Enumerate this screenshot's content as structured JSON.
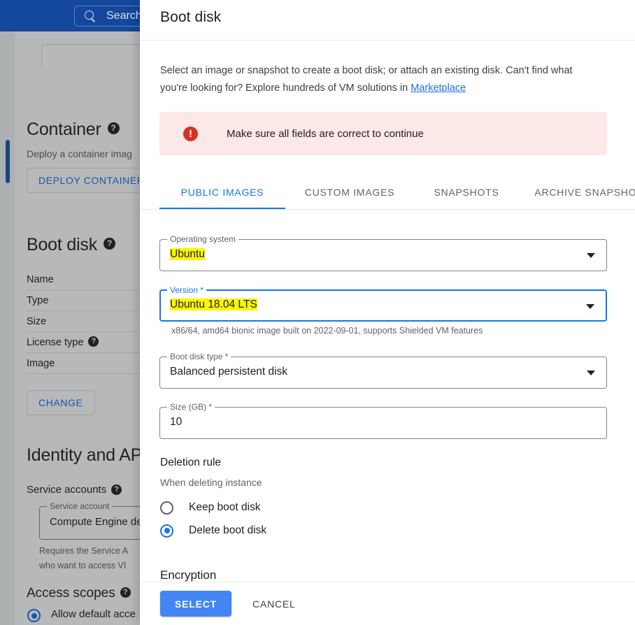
{
  "topbar": {
    "search_placeholder": "Search",
    "search_icon": "search-icon"
  },
  "background": {
    "container": {
      "heading": "Container",
      "help_icon": "?",
      "subtitle": "Deploy a container imag",
      "deploy_button": "DEPLOY CONTAINER"
    },
    "boot_disk": {
      "heading": "Boot disk",
      "help_icon": "?",
      "rows": [
        "Name",
        "Type",
        "Size",
        "License type",
        "Image"
      ],
      "license_help_icon": "?",
      "change_button": "CHANGE"
    },
    "identity": {
      "heading": "Identity and AP",
      "service_accounts_label": "Service accounts",
      "service_accounts_help_icon": "?",
      "service_account_field_label": "Service account",
      "service_account_value": "Compute Engine def",
      "hint_line1": "Requires the Service A",
      "hint_line2": "who want to access VI",
      "access_scopes_label": "Access scopes",
      "access_scopes_help_icon": "?",
      "access_scope_option": "Allow default acce"
    }
  },
  "dialog": {
    "title": "Boot disk",
    "description_part1": "Select an image or snapshot to create a boot disk; or attach an existing disk. Can't find what you're looking for? Explore hundreds of VM solutions in ",
    "description_link": "Marketplace",
    "alert": {
      "icon": "error-icon",
      "text": "Make sure all fields are correct to continue"
    },
    "tabs": [
      {
        "label": "PUBLIC IMAGES",
        "active": true
      },
      {
        "label": "CUSTOM IMAGES",
        "active": false
      },
      {
        "label": "SNAPSHOTS",
        "active": false
      },
      {
        "label": "ARCHIVE SNAPSHOTS",
        "active": false
      }
    ],
    "fields": {
      "operating_system": {
        "label": "Operating system",
        "value": "Ubuntu",
        "focused": false,
        "highlighted": true
      },
      "version": {
        "label": "Version *",
        "value": "Ubuntu 18.04 LTS",
        "focused": true,
        "highlighted": true,
        "help": "x86/64, amd64 bionic image built on 2022-09-01, supports Shielded VM features"
      },
      "boot_disk_type": {
        "label": "Boot disk type *",
        "value": "Balanced persistent disk",
        "focused": false,
        "highlighted": false
      },
      "size_gb": {
        "label": "Size (GB) *",
        "value": "10",
        "focused": false,
        "highlighted": false
      }
    },
    "deletion_rule": {
      "title": "Deletion rule",
      "subtitle": "When deleting instance",
      "options": [
        {
          "label": "Keep boot disk",
          "checked": false
        },
        {
          "label": "Delete boot disk",
          "checked": true
        }
      ]
    },
    "encryption": {
      "title": "Encryption"
    },
    "actions": {
      "select_label": "SELECT",
      "cancel_label": "CANCEL"
    }
  },
  "colors": {
    "brand_blue": "#1a73e8",
    "topbar_blue": "#14489c",
    "error_red": "#d93025",
    "error_bg": "#fce8e6",
    "highlight_yellow": "#fdf500",
    "primary_button": "#4285f4"
  }
}
